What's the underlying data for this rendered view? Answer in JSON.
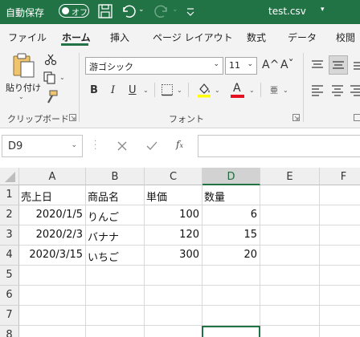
{
  "titlebar": {
    "autosave_label": "自動保存",
    "autosave_state": "オフ",
    "filename": "test.csv",
    "filename_caret": "▾",
    "bg_color": "#217346"
  },
  "menu": {
    "tabs": [
      "ファイル",
      "ホーム",
      "挿入",
      "ページ レイアウト",
      "数式",
      "データ",
      "校閲"
    ],
    "active_index": 1
  },
  "ribbon": {
    "clipboard": {
      "paste_label": "貼り付け",
      "group_label": "クリップボード"
    },
    "font": {
      "font_name": "游ゴシック",
      "font_size": "11",
      "group_label": "フォント",
      "bold": "B",
      "italic": "I",
      "underline": "U",
      "grow_font": "A^",
      "shrink_font": "Aˇ",
      "font_color_letter": "A",
      "phonetic_letter": "亜",
      "highlight_color": "#ffff00",
      "font_color": "#e81123"
    }
  },
  "formula_bar": {
    "name_box": "D9",
    "formula": ""
  },
  "grid": {
    "columns": [
      "A",
      "B",
      "C",
      "D",
      "E",
      "F"
    ],
    "selected_column": "D",
    "rows": [
      [
        "売上日",
        "商品名",
        "単価",
        "数量",
        "",
        ""
      ],
      [
        "2020/1/5",
        "りんご",
        "100",
        "6",
        "",
        ""
      ],
      [
        "2020/2/3",
        "バナナ",
        "120",
        "15",
        "",
        ""
      ],
      [
        "2020/3/15",
        "いちご",
        "300",
        "20",
        "",
        ""
      ],
      [
        "",
        "",
        "",
        "",
        "",
        ""
      ],
      [
        "",
        "",
        "",
        "",
        "",
        ""
      ],
      [
        "",
        "",
        "",
        "",
        "",
        ""
      ],
      [
        "",
        "",
        "",
        "",
        "",
        ""
      ]
    ],
    "row_numbers": [
      "1",
      "2",
      "3",
      "4",
      "5",
      "6",
      "7",
      "8"
    ],
    "active_cell": "D9"
  }
}
